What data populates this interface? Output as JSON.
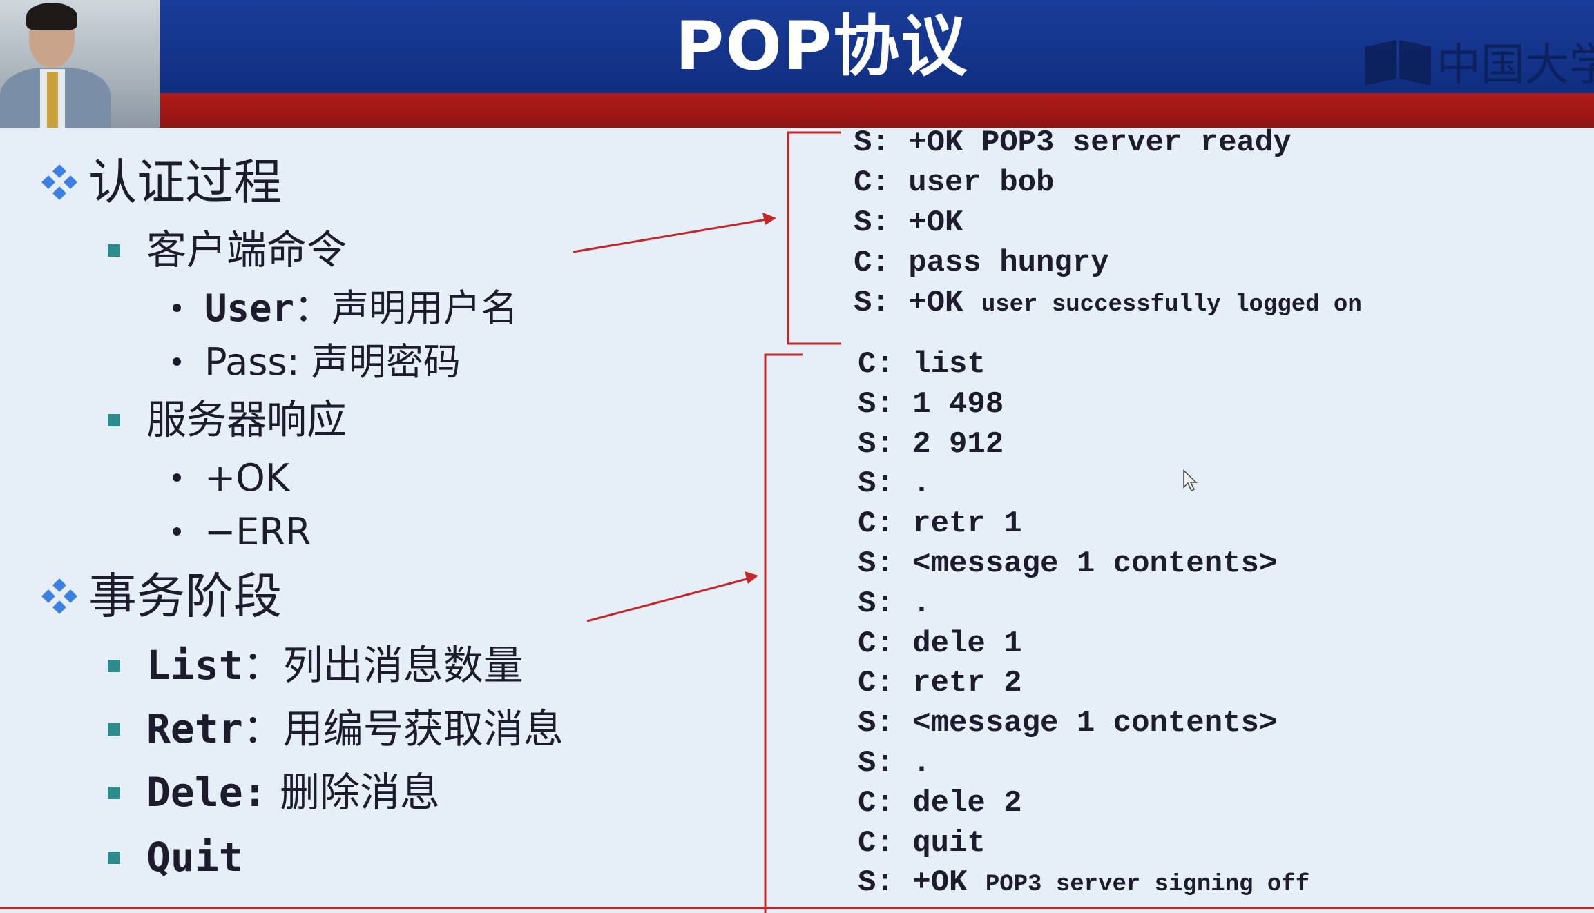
{
  "slide": {
    "title": "POP协议",
    "logo_text": "中国大学"
  },
  "outline": {
    "auth": {
      "heading": "认证过程",
      "client": {
        "label": "客户端命令",
        "items": [
          {
            "cmd": "User",
            "sep": "：",
            "desc": "声明用户名"
          },
          {
            "cmd": "Pass:",
            "sep": " ",
            "desc": "声明密码"
          }
        ]
      },
      "server": {
        "label": "服务器响应",
        "items": [
          "+OK",
          "−ERR"
        ]
      }
    },
    "transaction": {
      "heading": "事务阶段",
      "items": [
        {
          "cmd": "List",
          "sep": "：",
          "desc": "列出消息数量"
        },
        {
          "cmd": "Retr",
          "sep": "：",
          "desc": "用编号获取消息"
        },
        {
          "cmd": "Dele:",
          "sep": " ",
          "desc": "删除消息"
        },
        {
          "cmd": "Quit",
          "sep": "",
          "desc": ""
        }
      ]
    }
  },
  "transcript": {
    "auth_lines": [
      {
        "speaker": "S:",
        "text": "+OK POP3 server ready",
        "small": ""
      },
      {
        "speaker": "C:",
        "text": "user bob",
        "small": ""
      },
      {
        "speaker": "S:",
        "text": "+OK",
        "small": ""
      },
      {
        "speaker": "C:",
        "text": "pass hungry",
        "small": ""
      },
      {
        "speaker": "S:",
        "text": "+OK ",
        "small": "user successfully logged on"
      }
    ],
    "transaction_lines": [
      {
        "speaker": "C:",
        "text": "list",
        "small": ""
      },
      {
        "speaker": "S:",
        "text": "1 498",
        "small": ""
      },
      {
        "speaker": "S:",
        "text": "2 912",
        "small": ""
      },
      {
        "speaker": "S:",
        "text": ".",
        "small": ""
      },
      {
        "speaker": "C:",
        "text": "retr 1",
        "small": ""
      },
      {
        "speaker": "S:",
        "text": "<message 1 contents>",
        "small": ""
      },
      {
        "speaker": "S:",
        "text": ".",
        "small": ""
      },
      {
        "speaker": "C:",
        "text": "dele 1",
        "small": ""
      },
      {
        "speaker": "C:",
        "text": "retr 2",
        "small": ""
      },
      {
        "speaker": "S:",
        "text": "<message 1 contents>",
        "small": ""
      },
      {
        "speaker": "S:",
        "text": ".",
        "small": ""
      },
      {
        "speaker": "C:",
        "text": "dele 2",
        "small": ""
      },
      {
        "speaker": "C:",
        "text": "quit",
        "small": ""
      },
      {
        "speaker": "S:",
        "text": "+OK ",
        "small": "POP3 server signing off"
      }
    ]
  },
  "colors": {
    "header_blue": "#1a3d9a",
    "header_red": "#b21c18",
    "background": "#e6eff7",
    "accent_red": "#c4272a",
    "bullet_teal": "#2c8c8c",
    "diamond_blue": "#3d7fe0"
  }
}
